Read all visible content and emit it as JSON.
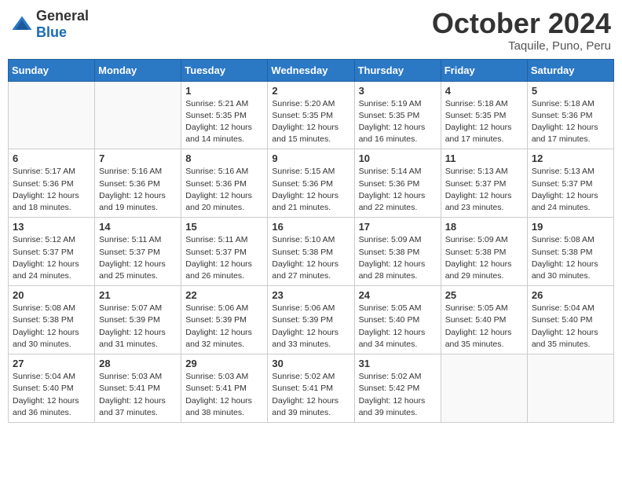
{
  "header": {
    "logo_general": "General",
    "logo_blue": "Blue",
    "month": "October 2024",
    "location": "Taquile, Puno, Peru"
  },
  "columns": [
    "Sunday",
    "Monday",
    "Tuesday",
    "Wednesday",
    "Thursday",
    "Friday",
    "Saturday"
  ],
  "weeks": [
    [
      {
        "day": "",
        "empty": true
      },
      {
        "day": "",
        "empty": true
      },
      {
        "day": "1",
        "sunrise": "Sunrise: 5:21 AM",
        "sunset": "Sunset: 5:35 PM",
        "daylight": "Daylight: 12 hours and 14 minutes."
      },
      {
        "day": "2",
        "sunrise": "Sunrise: 5:20 AM",
        "sunset": "Sunset: 5:35 PM",
        "daylight": "Daylight: 12 hours and 15 minutes."
      },
      {
        "day": "3",
        "sunrise": "Sunrise: 5:19 AM",
        "sunset": "Sunset: 5:35 PM",
        "daylight": "Daylight: 12 hours and 16 minutes."
      },
      {
        "day": "4",
        "sunrise": "Sunrise: 5:18 AM",
        "sunset": "Sunset: 5:35 PM",
        "daylight": "Daylight: 12 hours and 17 minutes."
      },
      {
        "day": "5",
        "sunrise": "Sunrise: 5:18 AM",
        "sunset": "Sunset: 5:36 PM",
        "daylight": "Daylight: 12 hours and 17 minutes."
      }
    ],
    [
      {
        "day": "6",
        "sunrise": "Sunrise: 5:17 AM",
        "sunset": "Sunset: 5:36 PM",
        "daylight": "Daylight: 12 hours and 18 minutes."
      },
      {
        "day": "7",
        "sunrise": "Sunrise: 5:16 AM",
        "sunset": "Sunset: 5:36 PM",
        "daylight": "Daylight: 12 hours and 19 minutes."
      },
      {
        "day": "8",
        "sunrise": "Sunrise: 5:16 AM",
        "sunset": "Sunset: 5:36 PM",
        "daylight": "Daylight: 12 hours and 20 minutes."
      },
      {
        "day": "9",
        "sunrise": "Sunrise: 5:15 AM",
        "sunset": "Sunset: 5:36 PM",
        "daylight": "Daylight: 12 hours and 21 minutes."
      },
      {
        "day": "10",
        "sunrise": "Sunrise: 5:14 AM",
        "sunset": "Sunset: 5:36 PM",
        "daylight": "Daylight: 12 hours and 22 minutes."
      },
      {
        "day": "11",
        "sunrise": "Sunrise: 5:13 AM",
        "sunset": "Sunset: 5:37 PM",
        "daylight": "Daylight: 12 hours and 23 minutes."
      },
      {
        "day": "12",
        "sunrise": "Sunrise: 5:13 AM",
        "sunset": "Sunset: 5:37 PM",
        "daylight": "Daylight: 12 hours and 24 minutes."
      }
    ],
    [
      {
        "day": "13",
        "sunrise": "Sunrise: 5:12 AM",
        "sunset": "Sunset: 5:37 PM",
        "daylight": "Daylight: 12 hours and 24 minutes."
      },
      {
        "day": "14",
        "sunrise": "Sunrise: 5:11 AM",
        "sunset": "Sunset: 5:37 PM",
        "daylight": "Daylight: 12 hours and 25 minutes."
      },
      {
        "day": "15",
        "sunrise": "Sunrise: 5:11 AM",
        "sunset": "Sunset: 5:37 PM",
        "daylight": "Daylight: 12 hours and 26 minutes."
      },
      {
        "day": "16",
        "sunrise": "Sunrise: 5:10 AM",
        "sunset": "Sunset: 5:38 PM",
        "daylight": "Daylight: 12 hours and 27 minutes."
      },
      {
        "day": "17",
        "sunrise": "Sunrise: 5:09 AM",
        "sunset": "Sunset: 5:38 PM",
        "daylight": "Daylight: 12 hours and 28 minutes."
      },
      {
        "day": "18",
        "sunrise": "Sunrise: 5:09 AM",
        "sunset": "Sunset: 5:38 PM",
        "daylight": "Daylight: 12 hours and 29 minutes."
      },
      {
        "day": "19",
        "sunrise": "Sunrise: 5:08 AM",
        "sunset": "Sunset: 5:38 PM",
        "daylight": "Daylight: 12 hours and 30 minutes."
      }
    ],
    [
      {
        "day": "20",
        "sunrise": "Sunrise: 5:08 AM",
        "sunset": "Sunset: 5:38 PM",
        "daylight": "Daylight: 12 hours and 30 minutes."
      },
      {
        "day": "21",
        "sunrise": "Sunrise: 5:07 AM",
        "sunset": "Sunset: 5:39 PM",
        "daylight": "Daylight: 12 hours and 31 minutes."
      },
      {
        "day": "22",
        "sunrise": "Sunrise: 5:06 AM",
        "sunset": "Sunset: 5:39 PM",
        "daylight": "Daylight: 12 hours and 32 minutes."
      },
      {
        "day": "23",
        "sunrise": "Sunrise: 5:06 AM",
        "sunset": "Sunset: 5:39 PM",
        "daylight": "Daylight: 12 hours and 33 minutes."
      },
      {
        "day": "24",
        "sunrise": "Sunrise: 5:05 AM",
        "sunset": "Sunset: 5:40 PM",
        "daylight": "Daylight: 12 hours and 34 minutes."
      },
      {
        "day": "25",
        "sunrise": "Sunrise: 5:05 AM",
        "sunset": "Sunset: 5:40 PM",
        "daylight": "Daylight: 12 hours and 35 minutes."
      },
      {
        "day": "26",
        "sunrise": "Sunrise: 5:04 AM",
        "sunset": "Sunset: 5:40 PM",
        "daylight": "Daylight: 12 hours and 35 minutes."
      }
    ],
    [
      {
        "day": "27",
        "sunrise": "Sunrise: 5:04 AM",
        "sunset": "Sunset: 5:40 PM",
        "daylight": "Daylight: 12 hours and 36 minutes."
      },
      {
        "day": "28",
        "sunrise": "Sunrise: 5:03 AM",
        "sunset": "Sunset: 5:41 PM",
        "daylight": "Daylight: 12 hours and 37 minutes."
      },
      {
        "day": "29",
        "sunrise": "Sunrise: 5:03 AM",
        "sunset": "Sunset: 5:41 PM",
        "daylight": "Daylight: 12 hours and 38 minutes."
      },
      {
        "day": "30",
        "sunrise": "Sunrise: 5:02 AM",
        "sunset": "Sunset: 5:41 PM",
        "daylight": "Daylight: 12 hours and 39 minutes."
      },
      {
        "day": "31",
        "sunrise": "Sunrise: 5:02 AM",
        "sunset": "Sunset: 5:42 PM",
        "daylight": "Daylight: 12 hours and 39 minutes."
      },
      {
        "day": "",
        "empty": true
      },
      {
        "day": "",
        "empty": true
      }
    ]
  ]
}
